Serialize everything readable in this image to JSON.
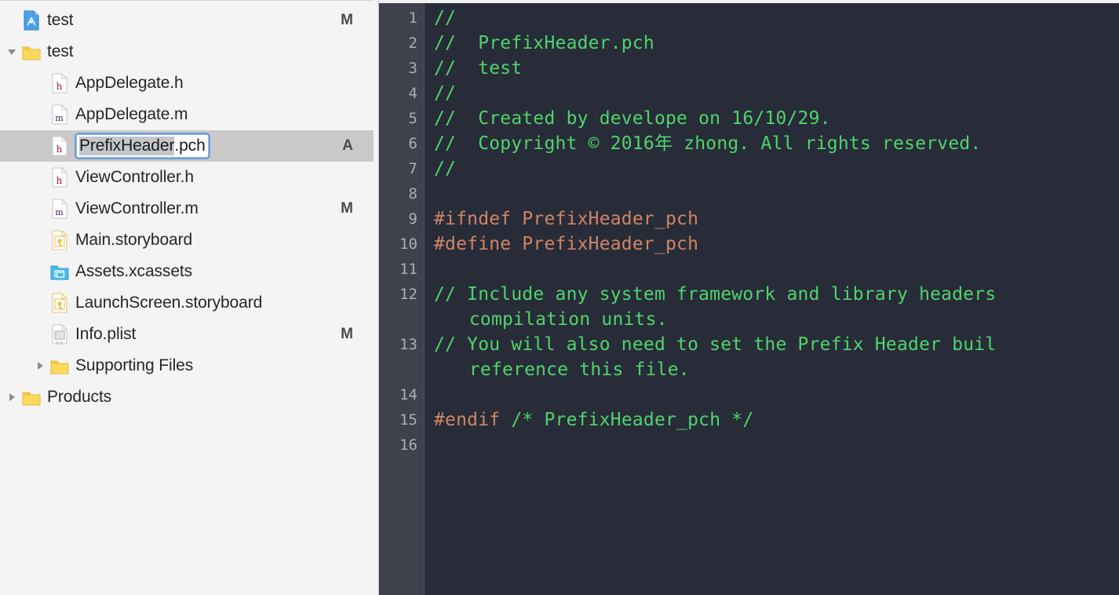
{
  "navigator": {
    "rows": [
      {
        "label": "test",
        "icon": "xcode-project-icon",
        "indent": 0,
        "disclosure": "none",
        "status": "M",
        "selected": false,
        "editing": false
      },
      {
        "label": "test",
        "icon": "folder-icon",
        "indent": 0,
        "disclosure": "open",
        "status": "",
        "selected": false,
        "editing": false
      },
      {
        "label": "AppDelegate.h",
        "icon": "header-file-icon",
        "indent": 1,
        "disclosure": "none",
        "status": "",
        "selected": false,
        "editing": false
      },
      {
        "label": "AppDelegate.m",
        "icon": "objc-file-icon",
        "indent": 1,
        "disclosure": "none",
        "status": "",
        "selected": false,
        "editing": false
      },
      {
        "label": "PrefixHeader.pch",
        "icon": "header-file-icon",
        "indent": 1,
        "disclosure": "none",
        "status": "A",
        "selected": true,
        "editing": true,
        "edit_selected_text": "PrefixHeader",
        "edit_remaining_text": ".pch"
      },
      {
        "label": "ViewController.h",
        "icon": "header-file-icon",
        "indent": 1,
        "disclosure": "none",
        "status": "",
        "selected": false,
        "editing": false
      },
      {
        "label": "ViewController.m",
        "icon": "objc-file-icon",
        "indent": 1,
        "disclosure": "none",
        "status": "M",
        "selected": false,
        "editing": false
      },
      {
        "label": "Main.storyboard",
        "icon": "storyboard-file-icon",
        "indent": 1,
        "disclosure": "none",
        "status": "",
        "selected": false,
        "editing": false
      },
      {
        "label": "Assets.xcassets",
        "icon": "xcassets-folder-icon",
        "indent": 1,
        "disclosure": "none",
        "status": "",
        "selected": false,
        "editing": false
      },
      {
        "label": "LaunchScreen.storyboard",
        "icon": "storyboard-file-icon",
        "indent": 1,
        "disclosure": "none",
        "status": "",
        "selected": false,
        "editing": false
      },
      {
        "label": "Info.plist",
        "icon": "plist-file-icon",
        "indent": 1,
        "disclosure": "none",
        "status": "M",
        "selected": false,
        "editing": false
      },
      {
        "label": "Supporting Files",
        "icon": "folder-icon",
        "indent": 1,
        "disclosure": "closed",
        "status": "",
        "selected": false,
        "editing": false
      },
      {
        "label": "Products",
        "icon": "folder-icon",
        "indent": 0,
        "disclosure": "closed",
        "status": "",
        "selected": false,
        "editing": false
      }
    ]
  },
  "editor": {
    "file_name": "PrefixHeader.pch",
    "line_numbers": [
      "1",
      "2",
      "3",
      "4",
      "5",
      "6",
      "7",
      "8",
      "9",
      "10",
      "11",
      "12",
      "",
      "13",
      "",
      "14",
      "15",
      "16"
    ],
    "lines": [
      {
        "n": "1",
        "tokens": [
          {
            "t": "//",
            "c": "cmt"
          }
        ]
      },
      {
        "n": "2",
        "tokens": [
          {
            "t": "//  PrefixHeader.pch",
            "c": "cmt"
          }
        ]
      },
      {
        "n": "3",
        "tokens": [
          {
            "t": "//  test",
            "c": "cmt"
          }
        ]
      },
      {
        "n": "4",
        "tokens": [
          {
            "t": "//",
            "c": "cmt"
          }
        ]
      },
      {
        "n": "5",
        "tokens": [
          {
            "t": "//  Created by develope on 16/10/29.",
            "c": "cmt"
          }
        ]
      },
      {
        "n": "6",
        "tokens": [
          {
            "t": "//  Copyright © 2016年 zhong. All rights reserved.",
            "c": "cmt"
          }
        ]
      },
      {
        "n": "7",
        "tokens": [
          {
            "t": "//",
            "c": "cmt"
          }
        ]
      },
      {
        "n": "8",
        "tokens": [
          {
            "t": "",
            "c": "cmt"
          }
        ]
      },
      {
        "n": "9",
        "tokens": [
          {
            "t": "#ifndef PrefixHeader_pch",
            "c": "prep"
          }
        ]
      },
      {
        "n": "10",
        "tokens": [
          {
            "t": "#define PrefixHeader_pch",
            "c": "prep"
          }
        ]
      },
      {
        "n": "11",
        "tokens": [
          {
            "t": "",
            "c": "cmt"
          }
        ]
      },
      {
        "n": "12",
        "tokens": [
          {
            "t": "// Include any system framework and library headers",
            "c": "cmt"
          }
        ],
        "wrap": "compilation units."
      },
      {
        "n": "13",
        "tokens": [
          {
            "t": "// You will also need to set the Prefix Header buil",
            "c": "cmt"
          }
        ],
        "wrap": "reference this file."
      },
      {
        "n": "14",
        "tokens": [
          {
            "t": "",
            "c": "cmt"
          }
        ]
      },
      {
        "n": "15",
        "tokens": [
          {
            "t": "#endif",
            "c": "prep"
          },
          {
            "t": " /* PrefixHeader_pch */",
            "c": "cmt"
          }
        ]
      },
      {
        "n": "16",
        "tokens": [
          {
            "t": "",
            "c": "cmt"
          }
        ]
      }
    ]
  },
  "colors": {
    "editor_background": "#282c38",
    "gutter_background": "#3d424d",
    "line_number": "#a9aeb8",
    "comment_green": "#4fd46d",
    "preprocessor_orange": "#cf8565",
    "sidebar_background": "#f4f4f4",
    "selection_gray": "#c9c9c9",
    "focus_ring_blue": "#5d96dd"
  }
}
